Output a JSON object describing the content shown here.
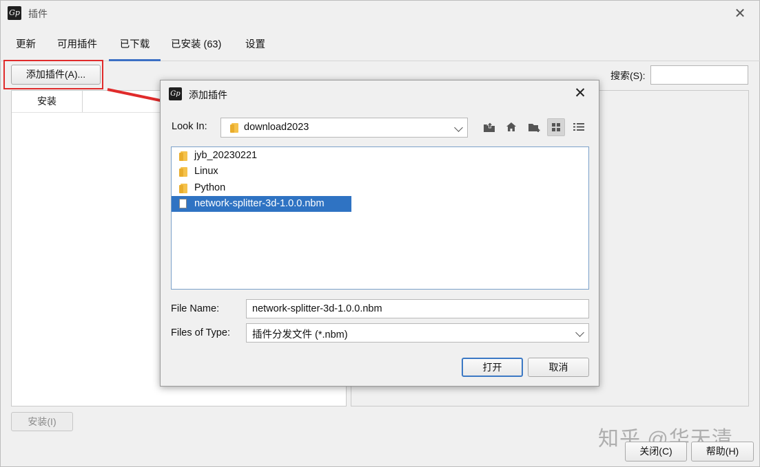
{
  "window": {
    "title": "插件",
    "app_icon_text": "Gp",
    "close_glyph": "✕"
  },
  "tabs": [
    {
      "label": "更新"
    },
    {
      "label": "可用插件"
    },
    {
      "label": "已下载",
      "active": true
    },
    {
      "label": "已安装 (63)"
    },
    {
      "label": "设置"
    }
  ],
  "toolbar": {
    "add_plugin_label": "添加插件(A)...",
    "search_label": "搜索(S):",
    "search_value": ""
  },
  "table": {
    "column_install": "安装"
  },
  "bottom": {
    "install_label": "安装(I)",
    "close_label": "关闭(C)",
    "help_label": "帮助(H)"
  },
  "watermark": "知乎 @华天清",
  "colors": {
    "accent": "#2f73c3",
    "highlight_box": "#e02b2b",
    "arrow": "#e02b2b"
  },
  "dialog": {
    "title": "添加插件",
    "app_icon_text": "Gp",
    "close_glyph": "✕",
    "look_in_label": "Look In:",
    "look_in_value": "download2023",
    "toolbar_icons": [
      "up-folder-icon",
      "home-icon",
      "new-folder-icon",
      "grid-view-icon",
      "list-view-icon"
    ],
    "files": [
      {
        "name": "jyb_20230221",
        "type": "folder",
        "selected": false
      },
      {
        "name": "Linux",
        "type": "folder",
        "selected": false
      },
      {
        "name": "Python",
        "type": "folder",
        "selected": false
      },
      {
        "name": "network-splitter-3d-1.0.0.nbm",
        "type": "file",
        "selected": true
      }
    ],
    "file_name_label": "File Name:",
    "file_name_value": "network-splitter-3d-1.0.0.nbm",
    "file_type_label": "Files of Type:",
    "file_type_value": "插件分发文件 (*.nbm)",
    "open_label": "打开",
    "cancel_label": "取消"
  }
}
